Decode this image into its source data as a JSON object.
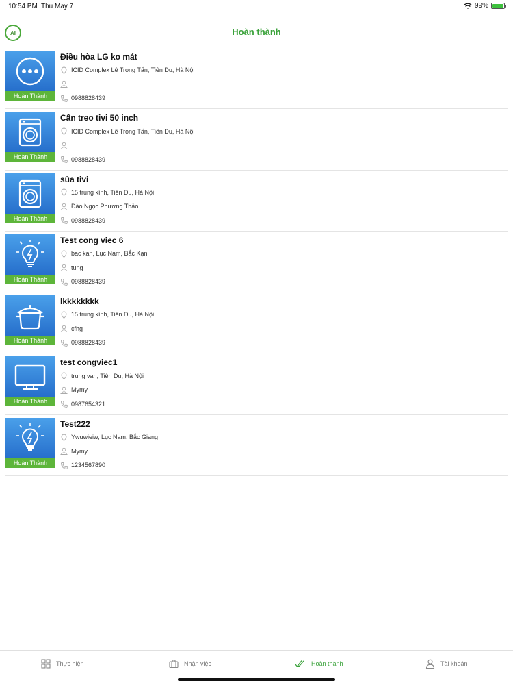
{
  "status": {
    "time": "10:54 PM",
    "date": "Thu May 7",
    "battery": "99%"
  },
  "header": {
    "logo_text": "AI",
    "title": "Hoàn thành"
  },
  "items": [
    {
      "title": "Điều hòa LG ko mát",
      "address": "ICID Complex Lê Trọng Tấn, Tiên Du, Hà Nội",
      "person": "",
      "phone": "0988828439",
      "badge": "Hoàn Thành",
      "icon": "dots-icon"
    },
    {
      "title": "Cẩn treo tivi 50 inch",
      "address": "ICID Complex Lê Trọng Tấn, Tiên Du, Hà Nội",
      "person": "",
      "phone": "0988828439",
      "badge": "Hoàn Thành",
      "icon": "washing-machine-icon"
    },
    {
      "title": "sủa tivi",
      "address": "15 trung kính, Tiên Du, Hà Nội",
      "person": "Đào Ngọc Phương Thảo",
      "phone": "0988828439",
      "badge": "Hoàn Thành",
      "icon": "washing-machine-icon"
    },
    {
      "title": "Test cong viec 6",
      "address": "bac kan, Lục Nam, Bắc Kạn",
      "person": "tung",
      "phone": "0988828439",
      "badge": "Hoàn Thành",
      "icon": "lightbulb-icon"
    },
    {
      "title": "lkkkkkkkk",
      "address": "15 trung kính, Tiên Du, Hà Nội",
      "person": "cfhg",
      "phone": "0988828439",
      "badge": "Hoàn Thành",
      "icon": "pot-icon"
    },
    {
      "title": "test congviec1",
      "address": "trung van, Tiên Du, Hà Nội",
      "person": "Mymy",
      "phone": "0987654321",
      "badge": "Hoàn Thành",
      "icon": "tv-icon"
    },
    {
      "title": "Test222",
      "address": "Ywuwieiw, Lục Nam, Bắc Giang",
      "person": "Mymy",
      "phone": "1234567890",
      "badge": "Hoàn Thành",
      "icon": "lightbulb-icon"
    }
  ],
  "tabs": [
    {
      "label": "Thực hiện",
      "icon": "grid-icon",
      "active": false
    },
    {
      "label": "Nhận việc",
      "icon": "briefcase-icon",
      "active": false
    },
    {
      "label": "Hoàn thành",
      "icon": "double-check-icon",
      "active": true
    },
    {
      "label": "Tài khoản",
      "icon": "user-icon",
      "active": false
    }
  ],
  "colors": {
    "accent": "#3aa23a",
    "thumb_top": "#4aa0ea",
    "thumb_bottom": "#1e63c4",
    "badge": "#5db53a"
  }
}
